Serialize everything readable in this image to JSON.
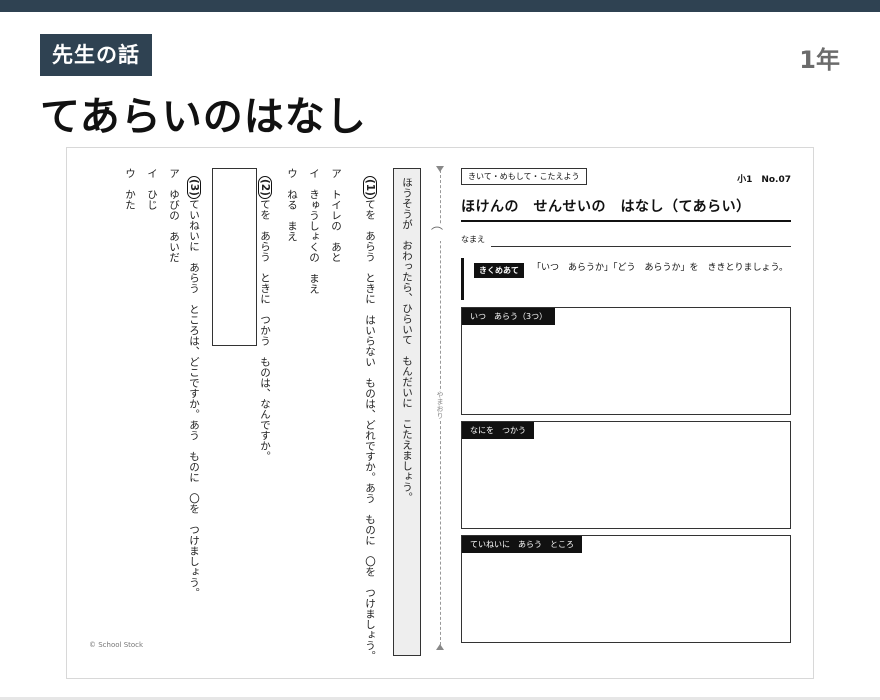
{
  "header": {
    "tag": "先生の話",
    "title": "てあらいのはなし",
    "grade": "1年"
  },
  "worksheet": {
    "left": {
      "instruction": "ほうそうが　おわったら、ひらいて　もんだいに　こたえましょう。",
      "q1": {
        "num": "(1)",
        "text": "てを　あらう　ときに　はいらない　ものは、どれですか。あう　ものに　〇を　つけましょう。",
        "options": [
          "ア　トイレの　あと",
          "イ　きゅうしょくの　まえ",
          "ウ　ねる　まえ"
        ]
      },
      "q2": {
        "num": "(2)",
        "text": "てを　あらう　ときに　つかう　ものは、なんですか。"
      },
      "q3": {
        "num": "(3)",
        "text": "ていねいに　あらう　ところは、どこですか。あう　ものに　〇を　つけましょう。",
        "options": [
          "ア　ゆびの　あいだ",
          "イ　ひじ",
          "ウ　かた"
        ]
      },
      "copyright": "© School Stock"
    },
    "fold_text": "やまおり",
    "right": {
      "instruction_tag": "きいて・めもして・こたえよう",
      "doc_number": "小1　No.07",
      "title": "ほけんの　せんせいの　はなし（てあらい）",
      "name_label": "なまえ",
      "key_badge": "きくめあて",
      "key_text": "「いつ　あらうか」「どう　あらうか」を　ききとりましょう。",
      "boxes": [
        {
          "label": "いつ　あらう（3つ）"
        },
        {
          "label": "なにを　つかう"
        },
        {
          "label": "ていねいに　あらう　ところ"
        }
      ]
    }
  }
}
